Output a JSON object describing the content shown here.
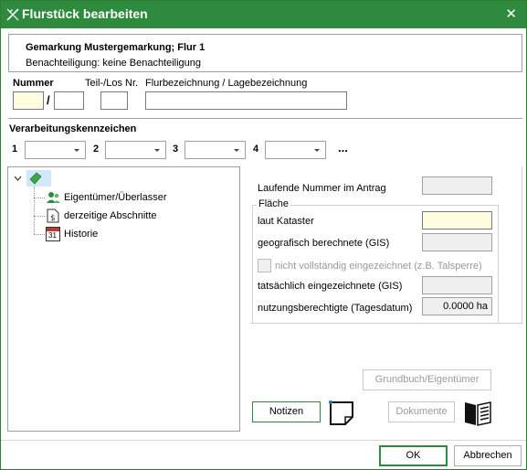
{
  "window": {
    "title": "Flurstück bearbeiten",
    "close_label": "✕"
  },
  "info": {
    "line1": "Gemarkung Mustergemarkung; Flur 1",
    "line2": "Benachteiligung:  keine Benachteiligung"
  },
  "ident": {
    "nummer_label": "Nummer",
    "slash": "/",
    "teil_label": "Teil-/Los Nr.",
    "flurbez_label": "Flurbezeichnung / Lagebezeichnung",
    "nummer_value": "",
    "nenner_value": "",
    "teil_value": "",
    "flurbez_value": ""
  },
  "kennzeichen": {
    "heading": "Verarbeitungskennzeichen",
    "items": [
      {
        "label": "1",
        "value": ""
      },
      {
        "label": "2",
        "value": ""
      },
      {
        "label": "3",
        "value": ""
      },
      {
        "label": "4",
        "value": ""
      }
    ],
    "more_label": "..."
  },
  "tree": {
    "items": [
      {
        "label": "Eigentümer/Überlasser",
        "icon": "owner-icon"
      },
      {
        "label": "derzeitige Abschnitte",
        "icon": "document-icon"
      },
      {
        "label": "Historie",
        "icon": "calendar-icon"
      }
    ],
    "calendar_day": "31"
  },
  "details": {
    "laufende_label": "Laufende Nummer im Antrag",
    "flaeche_label": "Fläche",
    "kataster_label": "laut Kataster",
    "gis_label": "geografisch berechnete (GIS)",
    "checkbox_label": "nicht vollständig eingezeichnet (z.B. Talsperre)",
    "eingezeichnet_label": "tatsächlich eingezeichnete (GIS)",
    "nutzung_label": "nutzungsberechtigte (Tagesdatum)",
    "nutzung_value": "0.0000 ha",
    "laufende_value": "",
    "kataster_value": "",
    "gis_value": "",
    "eingezeichnet_value": ""
  },
  "buttons": {
    "grundbuch": "Grundbuch/Eigentümer",
    "notizen": "Notizen",
    "dokumente": "Dokumente",
    "ok": "OK",
    "abbrechen": "Abbrechen"
  },
  "colors": {
    "titlebar": "#2e8b3e",
    "accent_green": "#2e8b3e",
    "required_field": "#fffde0"
  }
}
